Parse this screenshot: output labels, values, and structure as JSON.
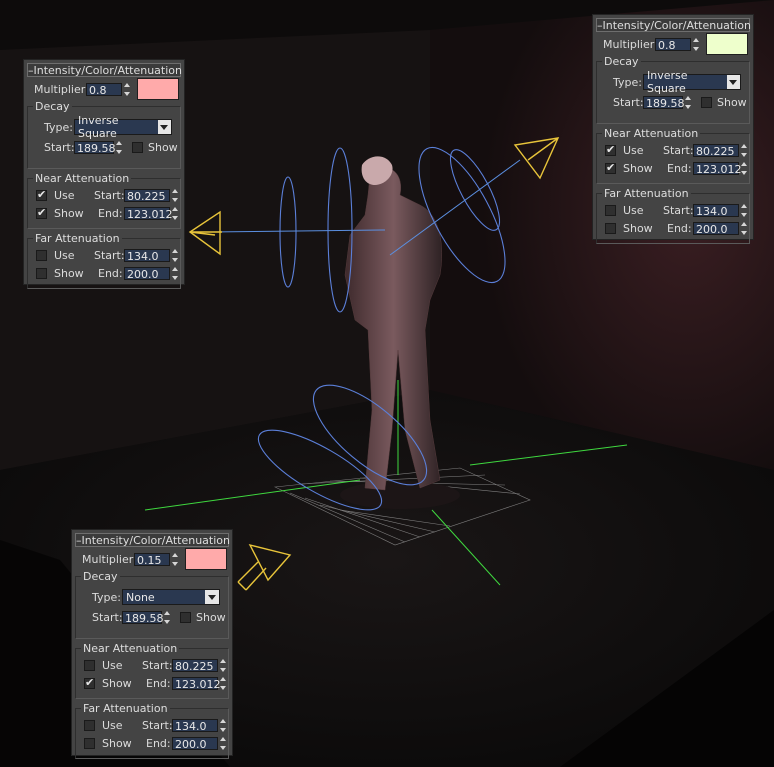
{
  "panels": [
    {
      "id": "left",
      "title": "Intensity/Color/Attenuation",
      "multiplier_label": "Multiplier:",
      "multiplier": "0.8",
      "color": "#ffaaaa",
      "decay_title": "Decay",
      "type_label": "Type:",
      "decay_type": "Inverse Square",
      "start_label": "Start:",
      "decay_start": "189.58",
      "show_label": "Show",
      "decay_show": false,
      "near_title": "Near Attenuation",
      "near_use_label": "Use",
      "near_use": true,
      "near_show_label": "Show",
      "near_show": true,
      "near_start_label": "Start:",
      "near_start": "80.225",
      "near_end_label": "End:",
      "near_end": "123.012",
      "far_title": "Far Attenuation",
      "far_use_label": "Use",
      "far_use": false,
      "far_show_label": "Show",
      "far_show": false,
      "far_start_label": "Start:",
      "far_start": "134.0",
      "far_end_label": "End:",
      "far_end": "200.0"
    },
    {
      "id": "right",
      "title": "Intensity/Color/Attenuation",
      "multiplier_label": "Multiplier:",
      "multiplier": "0.8",
      "color": "#eeffcc",
      "decay_title": "Decay",
      "type_label": "Type:",
      "decay_type": "Inverse Square",
      "start_label": "Start:",
      "decay_start": "189.58",
      "show_label": "Show",
      "decay_show": false,
      "near_title": "Near Attenuation",
      "near_use_label": "Use",
      "near_use": true,
      "near_show_label": "Show",
      "near_show": true,
      "near_start_label": "Start:",
      "near_start": "80.225",
      "near_end_label": "End:",
      "near_end": "123.012",
      "far_title": "Far Attenuation",
      "far_use_label": "Use",
      "far_use": false,
      "far_show_label": "Show",
      "far_show": false,
      "far_start_label": "Start:",
      "far_start": "134.0",
      "far_end_label": "End:",
      "far_end": "200.0"
    },
    {
      "id": "bottom",
      "title": "Intensity/Color/Attenuation",
      "multiplier_label": "Multiplier:",
      "multiplier": "0.15",
      "color": "#ffaaaa",
      "decay_title": "Decay",
      "type_label": "Type:",
      "decay_type": "None",
      "start_label": "Start:",
      "decay_start": "189.58",
      "show_label": "Show",
      "decay_show": false,
      "near_title": "Near Attenuation",
      "near_use_label": "Use",
      "near_use": false,
      "near_show_label": "Show",
      "near_show": true,
      "near_start_label": "Start:",
      "near_start": "80.225",
      "near_end_label": "End:",
      "near_end": "123.012",
      "far_title": "Far Attenuation",
      "far_use_label": "Use",
      "far_use": false,
      "far_show_label": "Show",
      "far_show": false,
      "far_start_label": "Start:",
      "far_start": "134.0",
      "far_end_label": "End:",
      "far_end": "200.0"
    }
  ],
  "scene": {
    "light_gizmo_color": "#e8c43a",
    "attenuation_color": "#5b7fd8",
    "axis_color": "#3fd83f"
  }
}
